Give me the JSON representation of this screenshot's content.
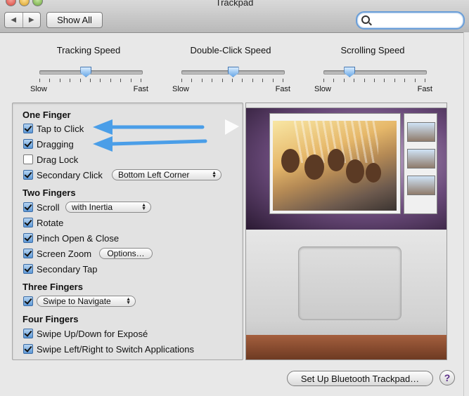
{
  "window": {
    "title": "Trackpad"
  },
  "toolbar": {
    "back_glyph": "◀",
    "forward_glyph": "▶",
    "show_all_label": "Show All",
    "search_value": ""
  },
  "sliders": [
    {
      "label": "Tracking Speed",
      "min_label": "Slow",
      "max_label": "Fast",
      "value": 0.45
    },
    {
      "label": "Double-Click Speed",
      "min_label": "Slow",
      "max_label": "Fast",
      "value": 0.5
    },
    {
      "label": "Scrolling Speed",
      "min_label": "Slow",
      "max_label": "Fast",
      "value": 0.25
    }
  ],
  "one_finger": {
    "heading": "One Finger",
    "tap_to_click": {
      "label": "Tap to Click",
      "checked": true
    },
    "dragging": {
      "label": "Dragging",
      "checked": true
    },
    "drag_lock": {
      "label": "Drag Lock",
      "checked": false
    },
    "secondary_click": {
      "label": "Secondary Click",
      "checked": true,
      "option": "Bottom Left Corner"
    }
  },
  "two_fingers": {
    "heading": "Two Fingers",
    "scroll": {
      "label": "Scroll",
      "checked": true,
      "option": "with Inertia"
    },
    "rotate": {
      "label": "Rotate",
      "checked": true
    },
    "pinch": {
      "label": "Pinch Open & Close",
      "checked": true
    },
    "screen_zoom": {
      "label": "Screen Zoom",
      "checked": true,
      "button": "Options…"
    },
    "secondary_tap": {
      "label": "Secondary Tap",
      "checked": true
    }
  },
  "three_fingers": {
    "heading": "Three Fingers",
    "navigate": {
      "checked": true,
      "option": "Swipe to Navigate"
    }
  },
  "four_fingers": {
    "heading": "Four Fingers",
    "expose": {
      "label": "Swipe Up/Down for Exposé",
      "checked": true
    },
    "switch_apps": {
      "label": "Swipe Left/Right to Switch Applications",
      "checked": true
    }
  },
  "footer": {
    "bluetooth_button": "Set Up Bluetooth Trackpad…",
    "help_glyph": "?"
  },
  "colors": {
    "annotation_arrow": "#4a9ee8",
    "accent": "#5d98d6",
    "help_glyph": "#5a2d88"
  }
}
